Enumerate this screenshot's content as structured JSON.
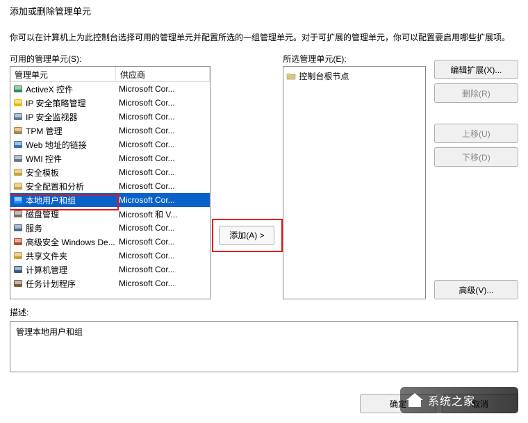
{
  "dialog": {
    "title": "添加或删除管理单元",
    "instruction": "你可以在计算机上为此控制台选择可用的管理单元并配置所选的一组管理单元。对于可扩展的管理单元，你可以配置要启用哪些扩展项。"
  },
  "available": {
    "label": "可用的管理单元(S):",
    "col_name": "管理单元",
    "col_vendor": "供应商",
    "items": [
      {
        "name": "ActiveX 控件",
        "vendor": "Microsoft Cor...",
        "icon": "activex"
      },
      {
        "name": "IP 安全策略管理",
        "vendor": "Microsoft Cor...",
        "icon": "ipsec"
      },
      {
        "name": "IP 安全监视器",
        "vendor": "Microsoft Cor...",
        "icon": "ipsecmon"
      },
      {
        "name": "TPM 管理",
        "vendor": "Microsoft Cor...",
        "icon": "tpm"
      },
      {
        "name": "Web 地址的链接",
        "vendor": "Microsoft Cor...",
        "icon": "link"
      },
      {
        "name": "WMI 控件",
        "vendor": "Microsoft Cor...",
        "icon": "wmi"
      },
      {
        "name": "安全模板",
        "vendor": "Microsoft Cor...",
        "icon": "sectmpl"
      },
      {
        "name": "安全配置和分析",
        "vendor": "Microsoft Cor...",
        "icon": "secconfig"
      },
      {
        "name": "本地用户和组",
        "vendor": "Microsoft Cor...",
        "icon": "users",
        "selected": true
      },
      {
        "name": "磁盘管理",
        "vendor": "Microsoft 和 V...",
        "icon": "disk"
      },
      {
        "name": "服务",
        "vendor": "Microsoft Cor...",
        "icon": "svc"
      },
      {
        "name": "高级安全 Windows De...",
        "vendor": "Microsoft Cor...",
        "icon": "firewall"
      },
      {
        "name": "共享文件夹",
        "vendor": "Microsoft Cor...",
        "icon": "share"
      },
      {
        "name": "计算机管理",
        "vendor": "Microsoft Cor...",
        "icon": "compmgmt"
      },
      {
        "name": "任务计划程序",
        "vendor": "Microsoft Cor...",
        "icon": "task"
      }
    ]
  },
  "selected": {
    "label": "所选管理单元(E):",
    "root": "控制台根节点"
  },
  "buttons": {
    "add": "添加(A) >",
    "edit_ext": "编辑扩展(X)...",
    "remove": "删除(R)",
    "move_up": "上移(U)",
    "move_down": "下移(D)",
    "advanced": "高级(V)...",
    "ok": "确定",
    "cancel": "取消"
  },
  "description": {
    "label": "描述:",
    "text": "管理本地用户和组"
  },
  "watermark": "系统之家",
  "icon_colors": {
    "activex": "#2e8b57",
    "ipsec": "#e6b800",
    "ipsecmon": "#5c7a99",
    "tpm": "#b0843a",
    "link": "#3a6fb0",
    "wmi": "#6b7a8f",
    "sectmpl": "#c9a03a",
    "secconfig": "#c9a03a",
    "users": "#1e90ff",
    "disk": "#7a6e5c",
    "svc": "#4a6a8a",
    "firewall": "#b94a2a",
    "share": "#c9a03a",
    "compmgmt": "#3a5a7a",
    "task": "#7a5c3a"
  }
}
